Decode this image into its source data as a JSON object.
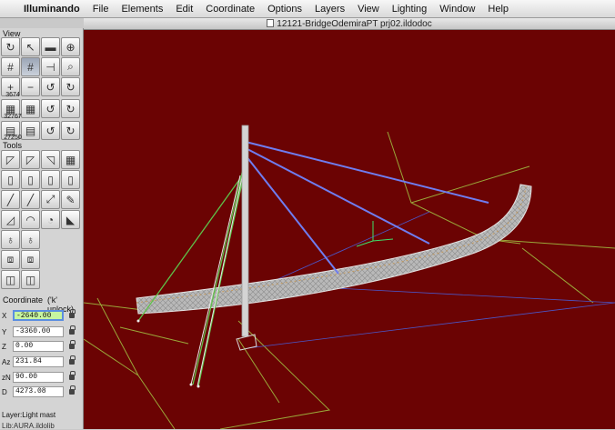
{
  "menubar": {
    "app_name": "Illuminando",
    "menus": [
      "File",
      "Elements",
      "Edit",
      "Coordinate",
      "Options",
      "Layers",
      "View",
      "Lighting",
      "Window",
      "Help"
    ]
  },
  "window": {
    "title": "12121-BridgeOdemiraPT prj02.ildodoc"
  },
  "panel": {
    "view_label": "View",
    "tools_label": "Tools",
    "zoom_values": [
      "3674",
      "32767",
      "27250"
    ],
    "coordinate_label": "Coordinate",
    "unlock_hint": "('k' unlock)",
    "coords": [
      {
        "label": "X",
        "value": "-2640.00"
      },
      {
        "label": "Y",
        "value": "-3360.00"
      },
      {
        "label": "Z",
        "value": "0.00"
      },
      {
        "label": "Az",
        "value": "231.84"
      },
      {
        "label": "zN",
        "value": "90.00"
      },
      {
        "label": "D",
        "value": "4273.08"
      }
    ],
    "layer_status": "Layer:Light mast",
    "lib_status": "Lib:AURA.ildolib"
  },
  "colors": {
    "viewport_bg": "#6b0303",
    "wire_green": "#9aa83a",
    "cable_blue": "#6f7df0",
    "deck_gray": "#b8b8b8"
  }
}
